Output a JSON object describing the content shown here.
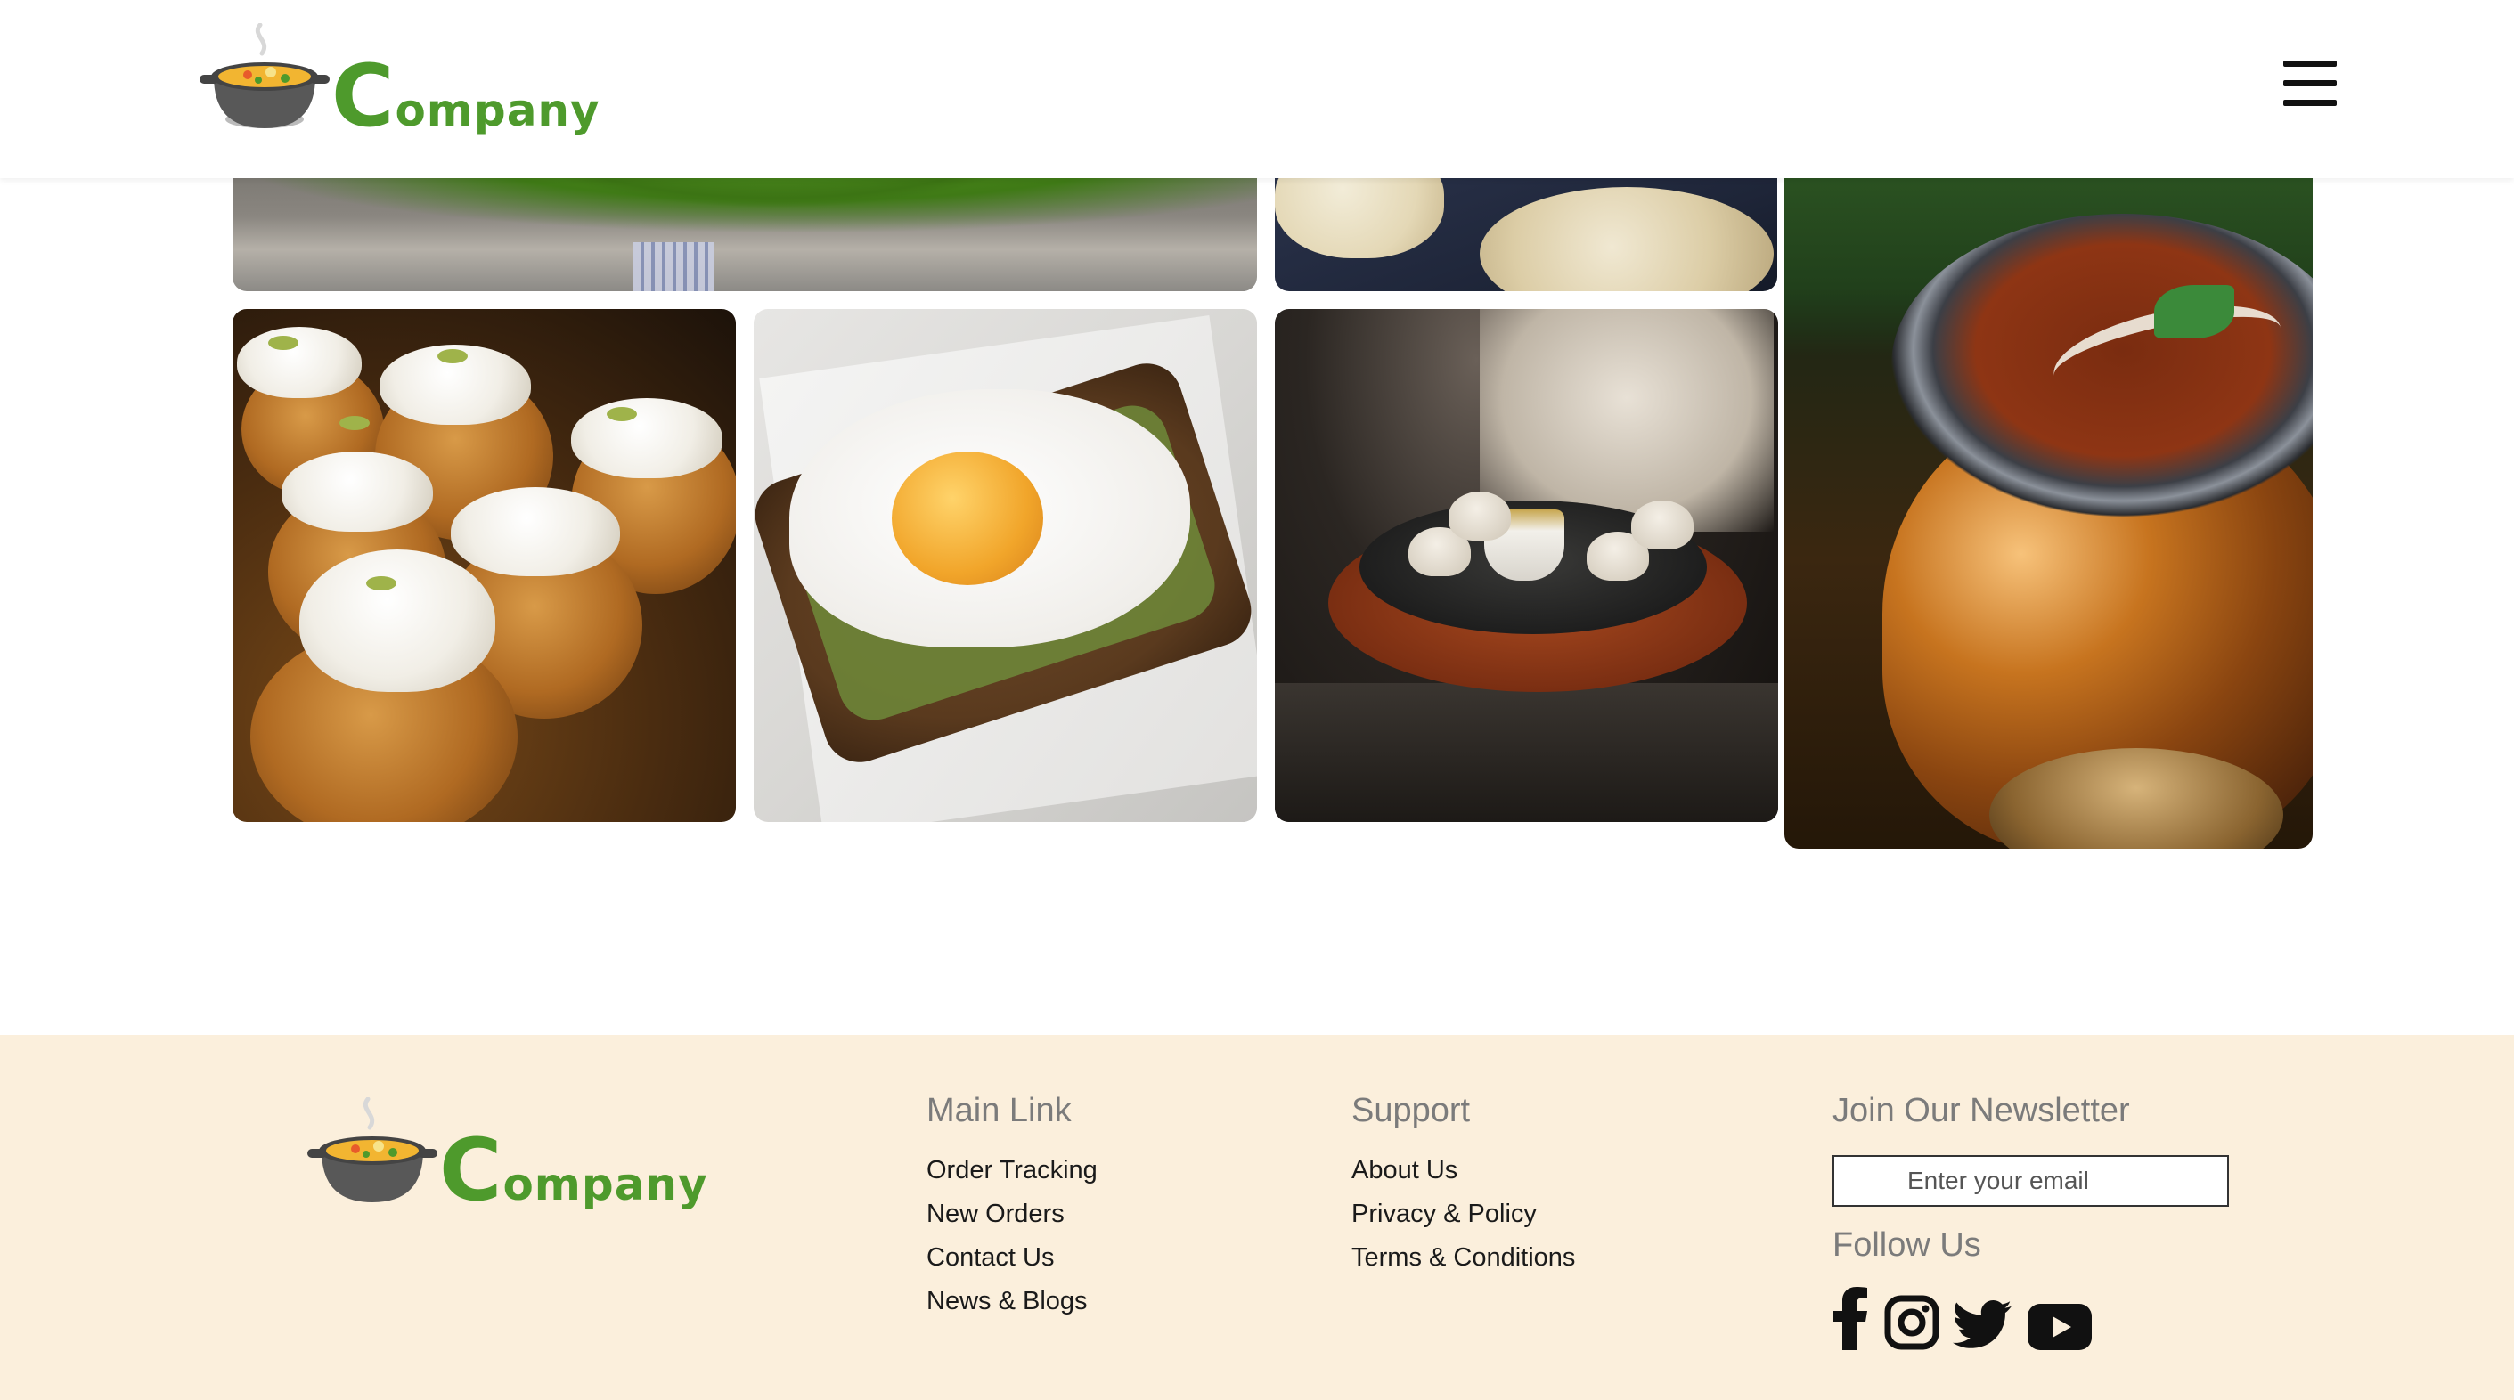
{
  "header": {
    "logo": {
      "brand_initial": "C",
      "brand_rest": "ompany",
      "icon": "soup-pot-logo-icon"
    },
    "menu_icon": "hamburger-menu-icon"
  },
  "gallery": {
    "photos": [
      {
        "subject": "banana leaf meal"
      },
      {
        "subject": "naan bread"
      },
      {
        "subject": "curry in copper pot"
      },
      {
        "subject": "cream cupcakes"
      },
      {
        "subject": "fried egg on toast"
      },
      {
        "subject": "momos on sizzler plate"
      }
    ]
  },
  "footer": {
    "logo": {
      "brand_initial": "C",
      "brand_rest": "ompany"
    },
    "main_link": {
      "title": "Main Link",
      "links": [
        "Order Tracking",
        "New Orders",
        "Contact Us",
        "News & Blogs"
      ]
    },
    "support": {
      "title": "Support",
      "links": [
        "About Us",
        "Privacy & Policy",
        "Terms & Conditions"
      ]
    },
    "newsletter": {
      "title": "Join Our Newsletter",
      "email_placeholder": "Enter your email"
    },
    "follow": {
      "title": "Follow Us",
      "icons": [
        "facebook-icon",
        "instagram-icon",
        "twitter-icon",
        "youtube-icon"
      ]
    }
  },
  "colors": {
    "brand_green": "#4e9a2c",
    "footer_bg": "#fbefdc",
    "heading_gray": "#7b7b7b"
  }
}
